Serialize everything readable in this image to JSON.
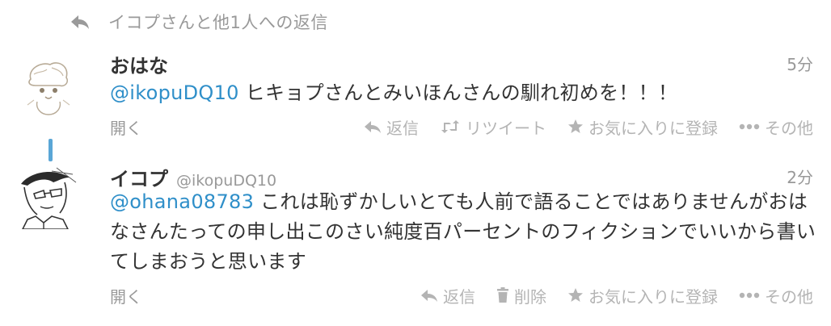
{
  "context": {
    "text": "イコプさんと他1人への返信"
  },
  "tweets": [
    {
      "fullname": "おはな",
      "username": "",
      "time": "5分",
      "mention": "@ikopuDQ10",
      "text": " ヒキョプさんとみいほんさんの馴れ初めを！！！",
      "open": "開く",
      "actions": {
        "reply": "返信",
        "retweet": "リツイート",
        "favorite": "お気に入りに登録",
        "more": "その他"
      }
    },
    {
      "fullname": "イコプ",
      "username": "@ikopuDQ10",
      "time": "2分",
      "mention": "@ohana08783",
      "text": " これは恥ずかしいとても人前で語ることではありませんがおはなさんたっての申し出このさい純度百パーセントのフィクションでいいから書いてしまおうと思います",
      "open": "開く",
      "actions": {
        "reply": "返信",
        "delete": "削除",
        "favorite": "お気に入りに登録",
        "more": "その他"
      }
    }
  ],
  "colors": {
    "link": "#2f8fc9",
    "muted": "#999999",
    "action": "#b4b4b4",
    "thread_line": "#5aa6d6"
  }
}
